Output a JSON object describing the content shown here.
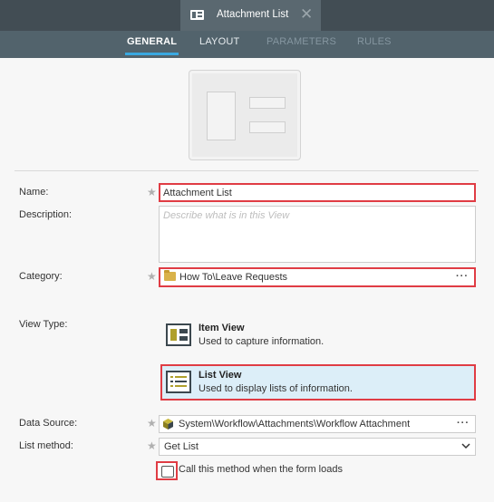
{
  "window": {
    "tab_title": "Attachment List",
    "tab_icon": "view-icon",
    "close_glyph": "✕"
  },
  "subnav": {
    "tabs": [
      {
        "label": "GENERAL",
        "state": "active"
      },
      {
        "label": "LAYOUT",
        "state": "normal"
      },
      {
        "label": "PARAMETERS",
        "state": "disabled"
      },
      {
        "label": "RULES",
        "state": "disabled"
      }
    ]
  },
  "form": {
    "name": {
      "label": "Name:",
      "required": true,
      "value": "Attachment List"
    },
    "description": {
      "label": "Description:",
      "required": false,
      "value": "",
      "placeholder": "Describe what is in this View"
    },
    "category": {
      "label": "Category:",
      "required": true,
      "value": "How To\\Leave Requests",
      "icon": "folder-icon",
      "browse": "···"
    },
    "view_type": {
      "label": "View Type:",
      "options": [
        {
          "title": "Item View",
          "description": "Used to capture information.",
          "icon": "item-view-icon",
          "selected": false
        },
        {
          "title": "List View",
          "description": "Used to display lists of information.",
          "icon": "list-view-icon",
          "selected": true
        }
      ]
    },
    "data_source": {
      "label": "Data Source:",
      "required": true,
      "value": "System\\Workflow\\Attachments\\Workflow Attachment",
      "icon": "smartobject-icon",
      "browse": "···"
    },
    "list_method": {
      "label": "List method:",
      "required": true,
      "value": "Get List",
      "options": [
        "Get List"
      ]
    },
    "call_on_load": {
      "label": "Call this method when the form loads",
      "checked": false
    }
  },
  "required_marker": "★",
  "colors": {
    "topbar": "#424d54",
    "subnav": "#52636c",
    "active_underline": "#3aa8e0",
    "highlight": "#e03c44",
    "selected_option_bg": "#dceef8"
  }
}
